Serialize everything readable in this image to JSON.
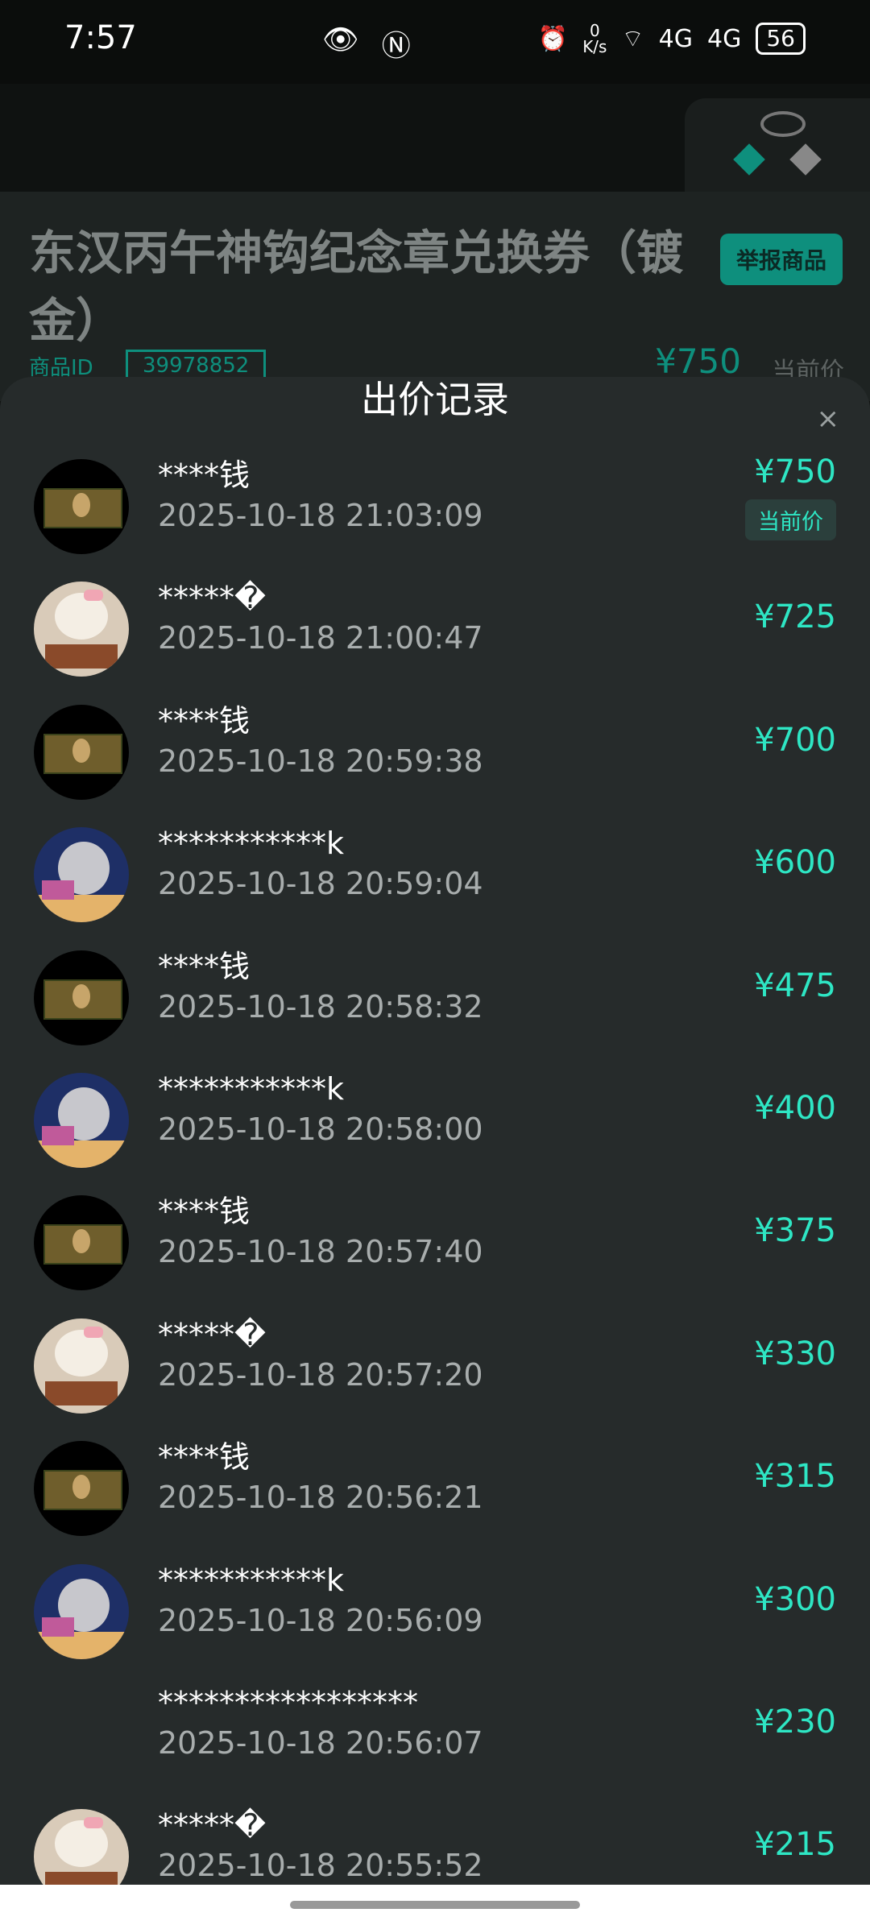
{
  "status_bar": {
    "time": "7:57",
    "net_speed_top": "0",
    "net_speed_bottom": "K/s",
    "signal1": "4G",
    "signal2": "4G",
    "battery": "56"
  },
  "product": {
    "title": "东汉丙午神钩纪念章兑换券（镀金）",
    "report_button": "举报商品",
    "id_label": "商品ID",
    "id_value": "39978852",
    "price": "¥750",
    "price_label": "当前价"
  },
  "modal": {
    "title": "出价记录",
    "close_icon": "×",
    "current_badge": "当前价",
    "bids": [
      {
        "avatar": "mona",
        "name": "****钱",
        "time": "2025-10-18 21:03:09",
        "price": "¥750",
        "current": true
      },
      {
        "avatar": "dog",
        "name": "*****�",
        "time": "2025-10-18 21:00:47",
        "price": "¥725"
      },
      {
        "avatar": "mona",
        "name": "****钱",
        "time": "2025-10-18 20:59:38",
        "price": "¥700"
      },
      {
        "avatar": "mouse",
        "name": "***********k",
        "time": "2025-10-18 20:59:04",
        "price": "¥600"
      },
      {
        "avatar": "mona",
        "name": "****钱",
        "time": "2025-10-18 20:58:32",
        "price": "¥475"
      },
      {
        "avatar": "mouse",
        "name": "***********k",
        "time": "2025-10-18 20:58:00",
        "price": "¥400"
      },
      {
        "avatar": "mona",
        "name": "****钱",
        "time": "2025-10-18 20:57:40",
        "price": "¥375"
      },
      {
        "avatar": "dog",
        "name": "*****�",
        "time": "2025-10-18 20:57:20",
        "price": "¥330"
      },
      {
        "avatar": "mona",
        "name": "****钱",
        "time": "2025-10-18 20:56:21",
        "price": "¥315"
      },
      {
        "avatar": "mouse",
        "name": "***********k",
        "time": "2025-10-18 20:56:09",
        "price": "¥300"
      },
      {
        "avatar": "blank",
        "name": "*****************",
        "time": "2025-10-18 20:56:07",
        "price": "¥230"
      },
      {
        "avatar": "dog",
        "name": "*****�",
        "time": "2025-10-18 20:55:52",
        "price": "¥215"
      }
    ]
  }
}
